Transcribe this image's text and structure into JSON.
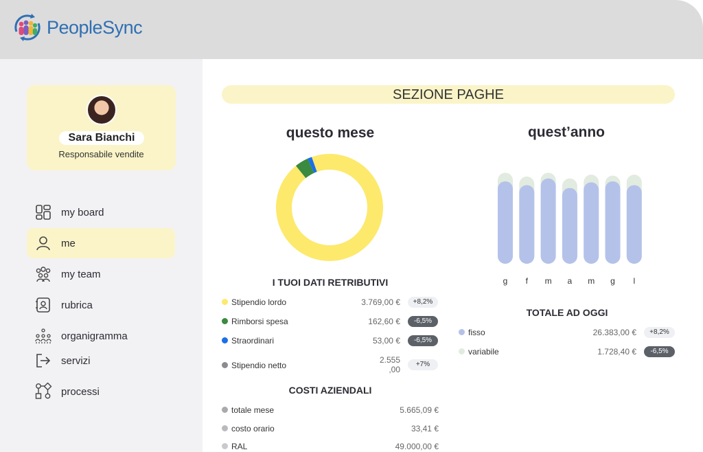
{
  "app": {
    "name": "PeopleSync"
  },
  "profile": {
    "name": "Sara Bianchi",
    "role": "Responsabile vendite"
  },
  "nav": [
    {
      "label": "my board",
      "icon": "dashboard-icon",
      "active": false
    },
    {
      "label": "me",
      "icon": "user-icon",
      "active": true
    },
    {
      "label": "my team",
      "icon": "team-icon",
      "active": false
    },
    {
      "label": "rubrica",
      "icon": "contacts-icon",
      "active": false
    },
    {
      "label": "organigramma",
      "icon": "org-chart-icon",
      "active": false
    },
    {
      "label": "servizi",
      "icon": "exit-icon",
      "active": false
    },
    {
      "label": "processi",
      "icon": "flowchart-icon",
      "active": false
    }
  ],
  "main": {
    "section_title": "SEZIONE PAGHE",
    "month_title": "questo mese",
    "year_title": "quest’anno",
    "dati_title": "I TUOI DATI RETRIBUTIVI",
    "dati": [
      {
        "label": "Stipendio lordo",
        "value": "3.769,00 €",
        "badge": "+8,2%",
        "trend": "pos",
        "color": "#fde96c"
      },
      {
        "label": "Rimborsi spesa",
        "value": "162,60 €",
        "badge": "-6,5%",
        "trend": "neg",
        "color": "#3a8a3f"
      },
      {
        "label": "Straordinari",
        "value": "53,00 €",
        "badge": "-6,5%",
        "trend": "neg",
        "color": "#1c6fe6"
      },
      {
        "label": "Stipendio netto",
        "value": "2.555\n,00",
        "badge": "+7%",
        "trend": "pos",
        "color": "#8a8c90"
      }
    ],
    "costi_title": "COSTI AZIENDALI",
    "costi": [
      {
        "label": "totale mese",
        "value": "5.665,09 €",
        "color": "#a8aaae"
      },
      {
        "label": "costo orario",
        "value": "33,41 €",
        "color": "#b8babe"
      },
      {
        "label": "RAL",
        "value": "49.000,00 €",
        "color": "#c8cacd"
      }
    ],
    "totale_title": "TOTALE AD OGGI",
    "totale": [
      {
        "label": "fisso",
        "value": "26.383,00 €",
        "badge": "+8,2%",
        "trend": "pos",
        "color": "#b4c2ea"
      },
      {
        "label": "variabile",
        "value": "1.728,40 €",
        "badge": "-6,5%",
        "trend": "neg",
        "color": "#e2ebe0"
      }
    ]
  },
  "chart_data": [
    {
      "type": "pie",
      "title": "questo mese",
      "categories": [
        "Stipendio lordo",
        "Rimborsi spesa",
        "Straordinari"
      ],
      "values": [
        3769.0,
        162.6,
        53.0
      ],
      "colors": [
        "#fde96c",
        "#3a8a3f",
        "#1c6fe6"
      ],
      "donut": true
    },
    {
      "type": "bar",
      "title": "quest’anno",
      "categories": [
        "g",
        "f",
        "m",
        "a",
        "m",
        "g",
        "l"
      ],
      "series": [
        {
          "name": "fisso",
          "values": [
            0.87,
            0.83,
            0.9,
            0.8,
            0.86,
            0.87,
            0.83
          ],
          "color": "#b4c2ea"
        },
        {
          "name": "variabile",
          "values": [
            0.09,
            0.09,
            0.06,
            0.1,
            0.08,
            0.06,
            0.11
          ],
          "color": "#e2ebe0"
        }
      ],
      "stacked": true,
      "ylim": [
        0,
        1
      ],
      "grid": false
    }
  ]
}
